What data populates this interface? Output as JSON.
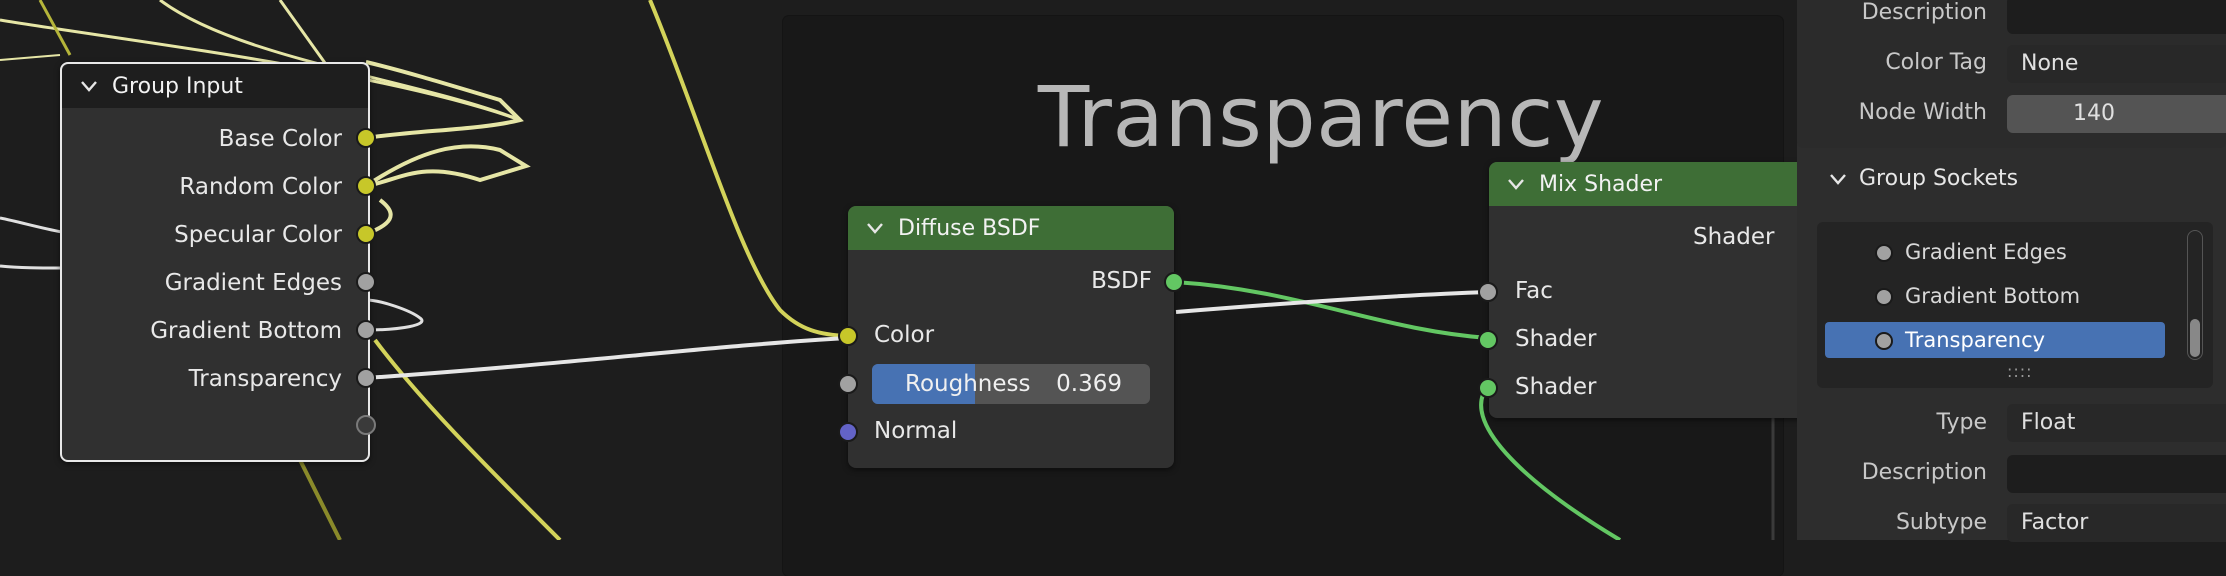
{
  "frame": {
    "title": "Transparency"
  },
  "group_input": {
    "title": "Group Input",
    "outputs": [
      "Base Color",
      "Random Color",
      "Specular Color",
      "Gradient Edges",
      "Gradient Bottom",
      "Transparency"
    ]
  },
  "diffuse": {
    "title": "Diffuse BSDF",
    "output": "BSDF",
    "color_label": "Color",
    "roughness_label": "Roughness",
    "roughness_value": "0.369",
    "roughness_fraction": 0.369,
    "normal_label": "Normal"
  },
  "mix": {
    "title": "Mix Shader",
    "output": "Shader",
    "fac_label": "Fac",
    "shader1_label": "Shader",
    "shader2_label": "Shader"
  },
  "panel": {
    "description_label": "Description",
    "color_tag_label": "Color Tag",
    "color_tag_value": "None",
    "node_width_label": "Node Width",
    "node_width_value": "140",
    "group_sockets_title": "Group Sockets",
    "sockets": [
      "Gradient Edges",
      "Gradient Bottom",
      "Transparency"
    ],
    "selected_socket": "Transparency",
    "type_label": "Type",
    "type_value": "Float",
    "socket_description_label": "Description",
    "subtype_label": "Subtype",
    "subtype_value": "Factor"
  },
  "colors": {
    "node_header_green": "#3e6e36",
    "group_header": "#1e1e1e",
    "socket_yellow": "#c7c729",
    "socket_green": "#63c763",
    "socket_gray": "#a1a1a1",
    "socket_blue": "#6363c7",
    "accent": "#4772b3"
  }
}
